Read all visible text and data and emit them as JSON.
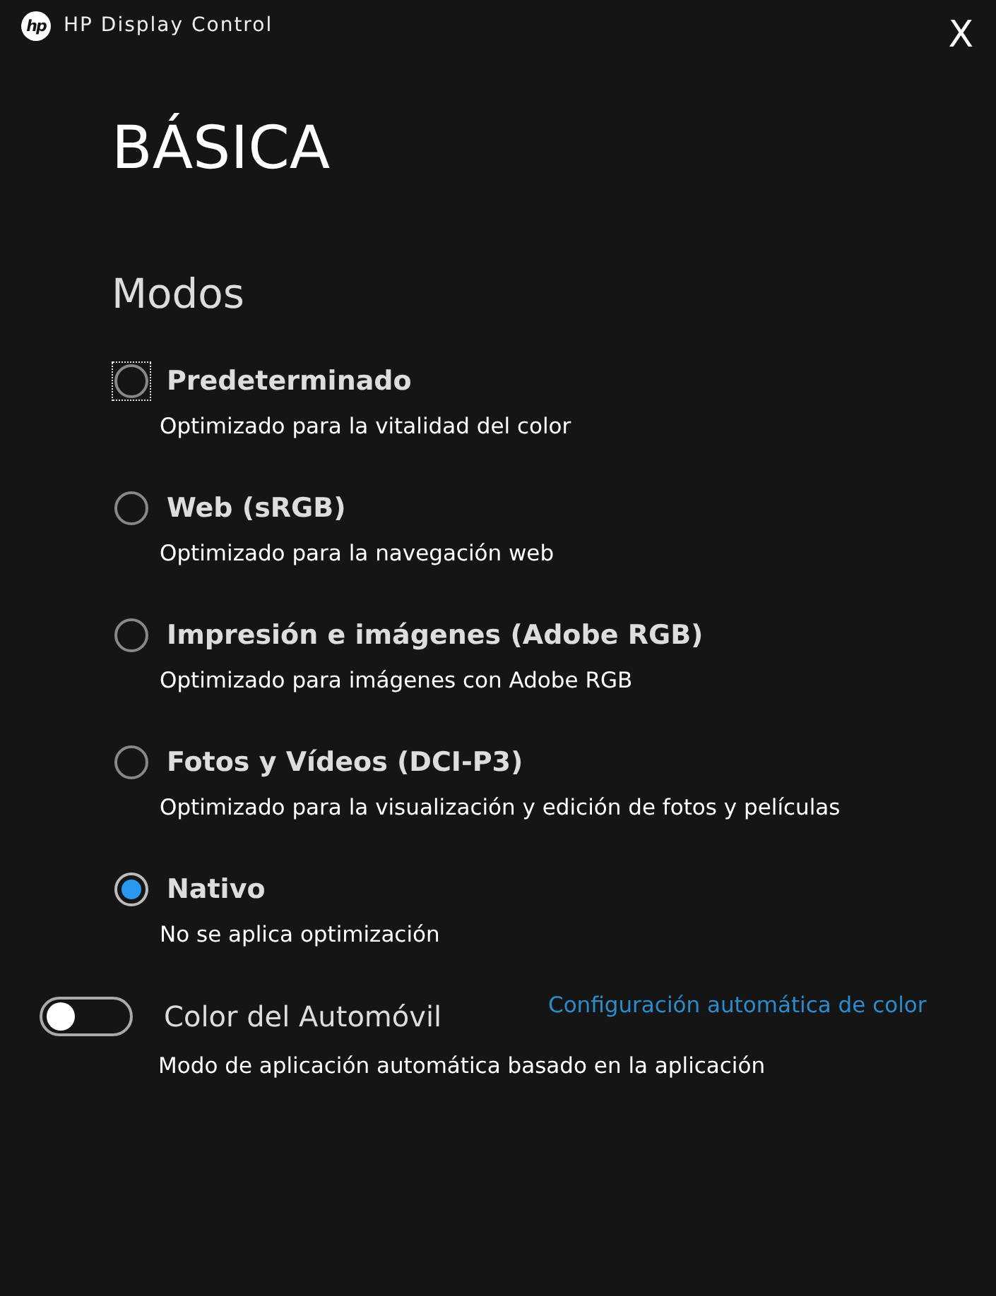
{
  "window": {
    "logo": "hp",
    "title": "HP Display Control",
    "close": "X"
  },
  "heading": "BÁSICA",
  "section": "Modos",
  "modes": [
    {
      "label": "Predeterminado",
      "description": "Optimizado para la vitalidad del color",
      "selected": false,
      "focused": true
    },
    {
      "label": "Web (sRGB)",
      "description": "Optimizado para la navegación web",
      "selected": false,
      "focused": false
    },
    {
      "label": "Impresión e imágenes (Adobe RGB)",
      "description": "Optimizado para imágenes con Adobe RGB",
      "selected": false,
      "focused": false
    },
    {
      "label": "Fotos y Vídeos (DCI-P3)",
      "description": "Optimizado para la visualización y edición de fotos y películas",
      "selected": false,
      "focused": false
    },
    {
      "label": "Nativo",
      "description": "No se aplica optimización",
      "selected": true,
      "focused": false
    }
  ],
  "auto_color": {
    "label": "Color del Automóvil",
    "on": false,
    "link": "Configuración automática de color",
    "description": "Modo de aplicación automática basado en la aplicación"
  }
}
